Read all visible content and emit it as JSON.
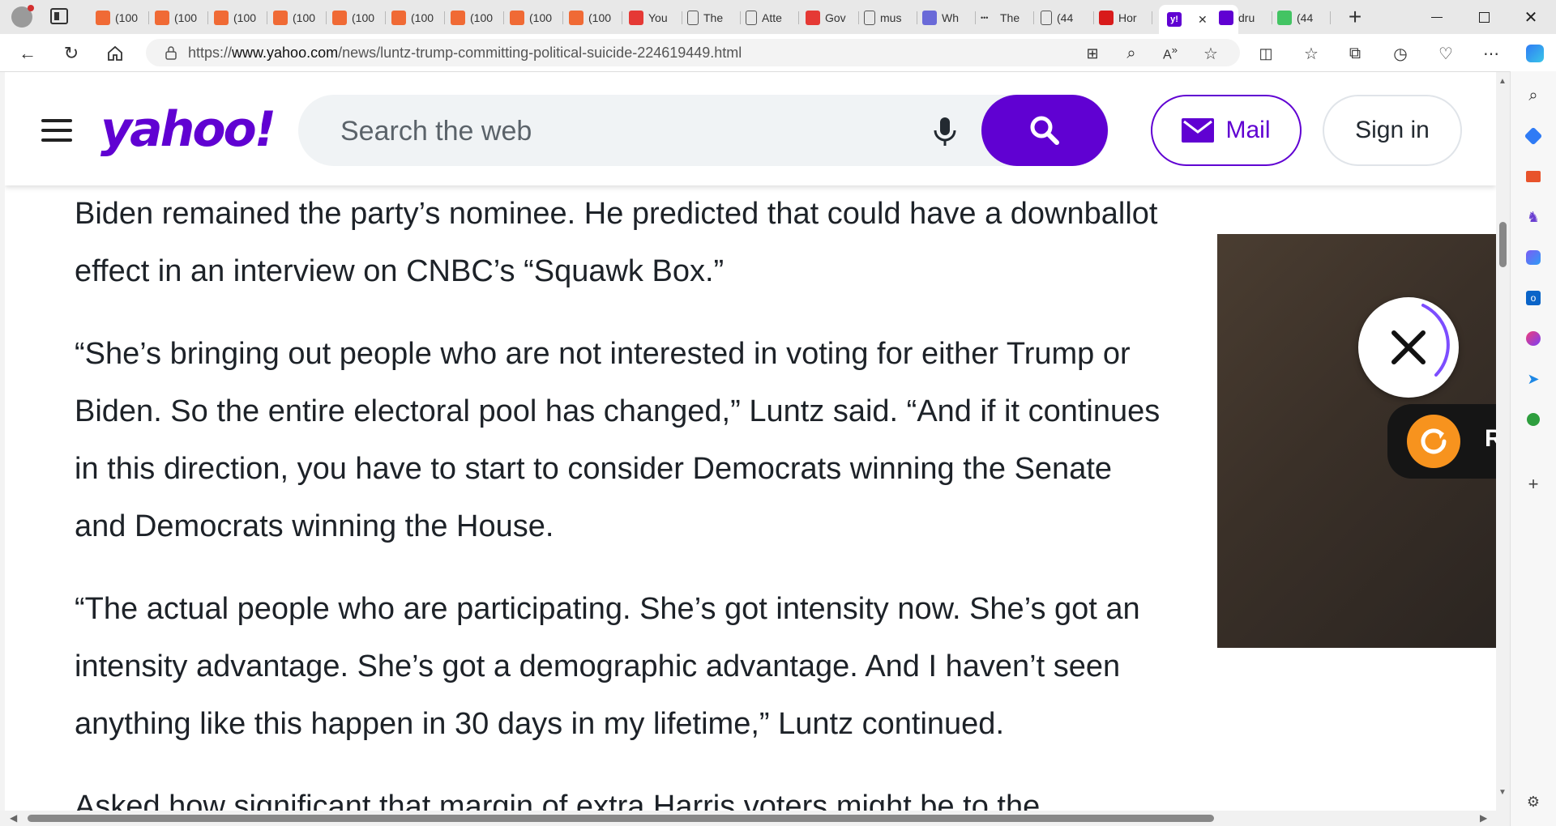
{
  "browser": {
    "tabs": [
      {
        "label": "(100",
        "favicon": "#f06a35"
      },
      {
        "label": "(100",
        "favicon": "#f06a35"
      },
      {
        "label": "(100",
        "favicon": "#f06a35"
      },
      {
        "label": "(100",
        "favicon": "#f06a35"
      },
      {
        "label": "(100",
        "favicon": "#f06a35"
      },
      {
        "label": "(100",
        "favicon": "#f06a35"
      },
      {
        "label": "(100",
        "favicon": "#f06a35"
      },
      {
        "label": "(100",
        "favicon": "#f06a35"
      },
      {
        "label": "(100",
        "favicon": "#f06a35"
      },
      {
        "label": "You",
        "favicon": "#e53935"
      },
      {
        "label": "The",
        "favicon": "doc"
      },
      {
        "label": "Atte",
        "favicon": "doc"
      },
      {
        "label": "Gov",
        "favicon": "#e53935"
      },
      {
        "label": "mus",
        "favicon": "doc"
      },
      {
        "label": "Wh",
        "favicon": "#6a6ad8"
      },
      {
        "label": "The",
        "favicon": "dots"
      },
      {
        "label": "(44",
        "favicon": "doc"
      },
      {
        "label": "Hor",
        "favicon": "#d81b1b"
      },
      {
        "label": "",
        "favicon": "#6001d2",
        "active": true
      },
      {
        "label": "dru",
        "favicon": "#6001d2"
      },
      {
        "label": "(44",
        "favicon": "#43c463"
      }
    ],
    "active_tab_favicon_text": "y!",
    "url_prefix": "https://",
    "url_host": "www.yahoo.com",
    "url_path": "/news/luntz-trump-committing-political-suicide-224619449.html"
  },
  "header": {
    "logo": "yahoo!",
    "search_placeholder": "Search the web",
    "mail_label": "Mail",
    "signin_label": "Sign in"
  },
  "article": {
    "paragraphs": [
      "Biden remained the party’s nominee. He predicted that could have a downballot effect in an interview on CNBC’s “Squawk Box.”",
      "“She’s bringing out people who are not interested in voting for either Trump or Biden. So the entire electoral pool has changed,” Luntz said. “And if it continues in this direction, you have to start to consider Democrats winning the Senate and Democrats winning the House.",
      "“The actual people who are participating. She’s got intensity now. She’s got an intensity advantage. She’s got a demographic advantage. And I haven’t seen anything like this happen in 30 days in my lifetime,” Luntz continued.",
      "Asked how significant that margin of extra Harris voters might be to the"
    ]
  },
  "ad": {
    "replay_label": "R"
  },
  "colors": {
    "yahoo_purple": "#6001d2",
    "text": "#1d2228"
  }
}
